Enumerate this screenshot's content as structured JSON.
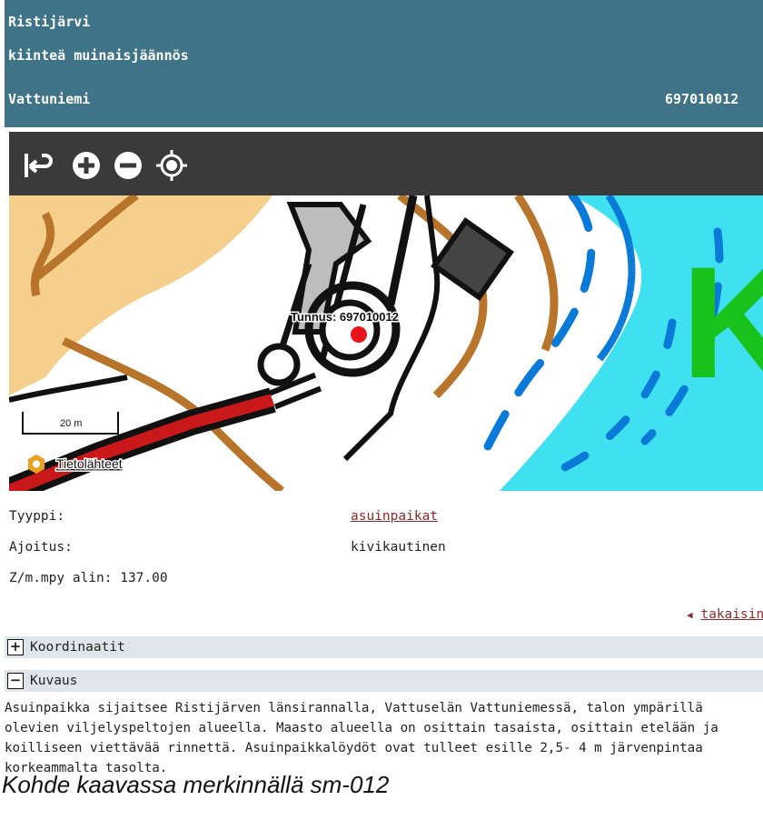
{
  "header": {
    "name": "Ristijärvi",
    "category": "kiinteä muinaisjäännös",
    "place": "Vattuniemi",
    "id_number": "69701001​2"
  },
  "toolbar": {
    "icons": [
      "back-icon",
      "zoom-in-icon",
      "zoom-out-icon",
      "locate-icon"
    ]
  },
  "map": {
    "feature_label": "Tunnus: 697010012",
    "scale_label": "20 m",
    "sources_link": "Tietolähteet",
    "big_letter": "K"
  },
  "info": {
    "type_label": "Tyyppi:",
    "type_value": "asuinpaikat",
    "dating_label": "Ajoitus:",
    "dating_value": "kivikautinen",
    "elevation_label": "Z/m.mpy alin: 137.00",
    "back_link": "takaisin"
  },
  "sections": {
    "coordinates_label": "Koordinaatit",
    "coordinates_symbol": "+",
    "description_label": "Kuvaus",
    "description_symbol": "−"
  },
  "description": {
    "line1": "Asuinpaikka sijaitsee Ristijärven länsirannalla, Vattuselän Vattuniemessä, talon ympärillä",
    "line2": "olevien viljelyspeltojen alueella. Maasto alueella on osittain tasaista, osittain etelään ja",
    "line3": "koilliseen viettävää rinnettä. Asuinpaikkalöydöt ovat tulleet esille 2,5- 4 m järvenpintaa",
    "line4": "korkeammalta tasolta."
  },
  "caption": "Kohde kaavassa merkinnällä sm-012",
  "colors": {
    "header_bg": "#3e7388",
    "toolbar_bg": "#3a3a3a",
    "water": "#3fe0f0",
    "field": "#f6cf8c",
    "road": "#c8181a",
    "link": "#8b2a2a"
  }
}
